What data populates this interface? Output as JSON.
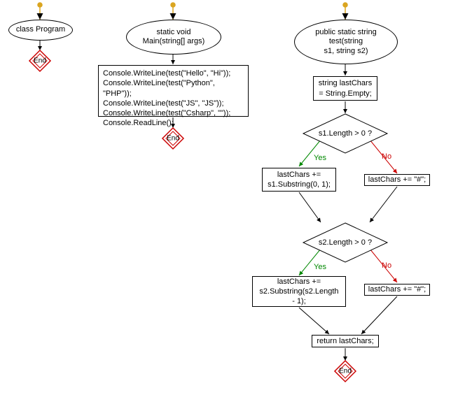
{
  "chart_data": {
    "type": "flowchart",
    "subgraphs": [
      {
        "name": "program",
        "nodes": [
          {
            "id": "n1",
            "shape": "ellipse",
            "label": "class Program"
          },
          {
            "id": "n1e",
            "shape": "end",
            "label": "End"
          }
        ],
        "edges": [
          {
            "from": "start",
            "to": "n1"
          },
          {
            "from": "n1",
            "to": "n1e"
          }
        ]
      },
      {
        "name": "main",
        "nodes": [
          {
            "id": "m1",
            "shape": "ellipse",
            "label_lines": [
              "static void",
              "Main(string[] args)"
            ]
          },
          {
            "id": "m2",
            "shape": "rect",
            "lines": [
              "Console.WriteLine(test(\"Hello\", \"Hi\"));",
              "Console.WriteLine(test(\"Python\", \"PHP\"));",
              "Console.WriteLine(test(\"JS\", \"JS\"));",
              "Console.WriteLine(test(\"Csharp\", \"\"));",
              "Console.ReadLine();"
            ]
          },
          {
            "id": "m2e",
            "shape": "end",
            "label": "End"
          }
        ],
        "edges": [
          {
            "from": "start",
            "to": "m1"
          },
          {
            "from": "m1",
            "to": "m2"
          },
          {
            "from": "m2",
            "to": "m2e"
          }
        ]
      },
      {
        "name": "test",
        "nodes": [
          {
            "id": "t1",
            "shape": "ellipse",
            "label_lines": [
              "public static string",
              "test(string",
              "s1, string s2)"
            ]
          },
          {
            "id": "t2",
            "shape": "rect",
            "label_lines": [
              "string lastChars",
              "= String.Empty;"
            ]
          },
          {
            "id": "t3",
            "shape": "diamond",
            "label": "s1.Length > 0 ?"
          },
          {
            "id": "t4",
            "shape": "rect",
            "label_lines": [
              "lastChars +=",
              "s1.Substring(0, 1);"
            ]
          },
          {
            "id": "t5",
            "shape": "rect",
            "label": "lastChars += \"#\";"
          },
          {
            "id": "t6",
            "shape": "diamond",
            "label": "s2.Length > 0 ?"
          },
          {
            "id": "t7",
            "shape": "rect",
            "label_lines": [
              "lastChars +=",
              "s2.Substring(s2.Length",
              "- 1);"
            ]
          },
          {
            "id": "t8",
            "shape": "rect",
            "label": "lastChars += \"#\";"
          },
          {
            "id": "t9",
            "shape": "rect",
            "label": "return lastChars;"
          },
          {
            "id": "t9e",
            "shape": "end",
            "label": "End"
          }
        ],
        "edges": [
          {
            "from": "start",
            "to": "t1"
          },
          {
            "from": "t1",
            "to": "t2"
          },
          {
            "from": "t2",
            "to": "t3"
          },
          {
            "from": "t3",
            "to": "t4",
            "label": "Yes",
            "label_color": "green"
          },
          {
            "from": "t3",
            "to": "t5",
            "label": "No",
            "label_color": "red"
          },
          {
            "from": "t4",
            "to": "t6"
          },
          {
            "from": "t5",
            "to": "t6"
          },
          {
            "from": "t6",
            "to": "t7",
            "label": "Yes",
            "label_color": "green"
          },
          {
            "from": "t6",
            "to": "t8",
            "label": "No",
            "label_color": "red"
          },
          {
            "from": "t7",
            "to": "t9"
          },
          {
            "from": "t8",
            "to": "t9"
          },
          {
            "from": "t9",
            "to": "t9e"
          }
        ]
      }
    ]
  },
  "labels": {
    "n1": "class Program",
    "end": "End",
    "m1_l1": "static void",
    "m1_l2": "Main(string[] args)",
    "m2_l1": "Console.WriteLine(test(\"Hello\", \"Hi\"));",
    "m2_l2": "Console.WriteLine(test(\"Python\", \"PHP\"));",
    "m2_l3": "Console.WriteLine(test(\"JS\", \"JS\"));",
    "m2_l4": "Console.WriteLine(test(\"Csharp\", \"\"));",
    "m2_l5": "Console.ReadLine();",
    "t1_l1": "public static string",
    "t1_l2": "test(string",
    "t1_l3": "s1, string s2)",
    "t2_l1": "string lastChars",
    "t2_l2": "= String.Empty;",
    "t3": "s1.Length > 0 ?",
    "t4_l1": "lastChars +=",
    "t4_l2": "s1.Substring(0, 1);",
    "t5": "lastChars += \"#\";",
    "t6": "s2.Length > 0 ?",
    "t7_l1": "lastChars +=",
    "t7_l2": "s2.Substring(s2.Length",
    "t7_l3": "- 1);",
    "t8": "lastChars += \"#\";",
    "t9": "return lastChars;",
    "yes": "Yes",
    "no": "No"
  }
}
